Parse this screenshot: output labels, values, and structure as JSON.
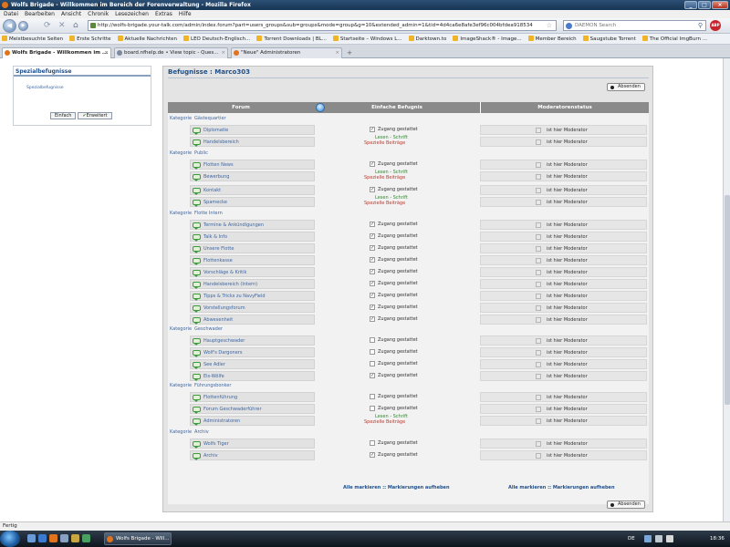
{
  "window": {
    "title": "Wolfs Brigade - Willkommen im Bereich der Forenverwaltung - Mozilla Firefox",
    "buttons": [
      "_",
      "□",
      "×"
    ]
  },
  "menu": [
    "Datei",
    "Bearbeiten",
    "Ansicht",
    "Chronik",
    "Lesezeichen",
    "Extras",
    "Hilfe"
  ],
  "nav": {
    "url": "http://wolfs-brigade.your-talk.com/admin/index.forum?part=users_groups&sub=groups&mode=group&g=10&extended_admin=1&tid=4d4ca6e8afe3ef96c004bfdea918534",
    "search_placeholder": "DAEMON Search",
    "abp": "ABP"
  },
  "bookmarks": [
    "Meistbesuchte Seiten",
    "Erste Schritte",
    "Aktuelle Nachrichten",
    "LEO Deutsch-Englisch...",
    "Torrent Downloads | BL...",
    "Startseite – Windows L...",
    "Darktown.to",
    "ImageShack® - Image...",
    "Member Bereich",
    "Saugstube Torrent",
    "The Official ImgBurn ..."
  ],
  "tabs": [
    {
      "label": "Wolfs Brigade - Willkommen im ...",
      "active": true
    },
    {
      "label": "board.nfhelp.de • View topic - Ques...",
      "active": false
    },
    {
      "label": "\"Neue\" Administratoren",
      "active": false
    }
  ],
  "sidebar": {
    "title": "Spezialbefugnisse",
    "item": "Spezialbefugnisse",
    "btn_simple": "Einfach",
    "btn_extended": "Erweitert"
  },
  "main": {
    "title": "Befugnisse : Marco303",
    "submit": "Absenden"
  },
  "grid": {
    "col_forum": "Forum",
    "col_simple": "Einfache Befugnis",
    "col_mod": "Moderatorenstatus",
    "cat_label": "Kategorie",
    "access": "Zugang gestattet",
    "read": "Lesen",
    "write": "Schrift",
    "special": "Spezielle Beiträge",
    "mod_label": "ist hier Moderator",
    "mark_all": "Alle markieren",
    "unmark_all": "Markierungen aufheben",
    "categories": [
      {
        "name": "Gästequartier",
        "forums": [
          {
            "name": "Diplomatie",
            "perm": "access",
            "checked": true
          },
          {
            "name": "Handelsbereich",
            "perm": "special",
            "checked": false
          }
        ]
      },
      {
        "name": "Public",
        "forums": [
          {
            "name": "Flotten News",
            "perm": "access",
            "checked": true
          },
          {
            "name": "Bewerbung",
            "perm": "special",
            "checked": false
          },
          {
            "name": "Kontakt",
            "perm": "access",
            "checked": true
          },
          {
            "name": "Spamecke",
            "perm": "special",
            "checked": false
          }
        ]
      },
      {
        "name": "Flotte Intern",
        "forums": [
          {
            "name": "Termine & Ankündigungen",
            "perm": "access",
            "checked": true
          },
          {
            "name": "Talk & Info",
            "perm": "access",
            "checked": true
          },
          {
            "name": "Unsere Flotte",
            "perm": "access",
            "checked": true
          },
          {
            "name": "Flottenkasse",
            "perm": "access",
            "checked": true
          },
          {
            "name": "Vorschläge & Kritik",
            "perm": "access",
            "checked": true
          },
          {
            "name": "Handelsbereich (Intern)",
            "perm": "access",
            "checked": true
          },
          {
            "name": "Tipps & Tricks zu NavyField",
            "perm": "access",
            "checked": true
          },
          {
            "name": "Vorstellungsforum",
            "perm": "access",
            "checked": true
          },
          {
            "name": "Abwesenheit",
            "perm": "access",
            "checked": true
          }
        ]
      },
      {
        "name": "Geschwader",
        "forums": [
          {
            "name": "Hauptgeschwader",
            "perm": "access",
            "checked": false
          },
          {
            "name": "Wolf's Dargoners",
            "perm": "access",
            "checked": false
          },
          {
            "name": "See Adler",
            "perm": "access",
            "checked": false
          },
          {
            "name": "Eis-Wölfe",
            "perm": "access",
            "checked": true
          }
        ]
      },
      {
        "name": "Führungsbonker",
        "forums": [
          {
            "name": "Flottenführung",
            "perm": "access",
            "checked": false
          },
          {
            "name": "Forum Geschwaderführer",
            "perm": "access",
            "checked": false
          },
          {
            "name": "Administratoren",
            "perm": "special",
            "checked": false
          }
        ]
      },
      {
        "name": "Archiv",
        "forums": [
          {
            "name": "Wolfs Tiger",
            "perm": "access",
            "checked": false
          },
          {
            "name": "Archiv",
            "perm": "access",
            "checked": true
          }
        ]
      }
    ]
  },
  "status": "Fertig",
  "taskbar": {
    "task": "Wolfs Brigade - Will...",
    "lang": "DE",
    "clock": "18:36"
  },
  "colors": {
    "accent": "#1f4f8a",
    "link": "#3d66a3",
    "read": "#2e8b2e",
    "special": "#c0392b"
  }
}
